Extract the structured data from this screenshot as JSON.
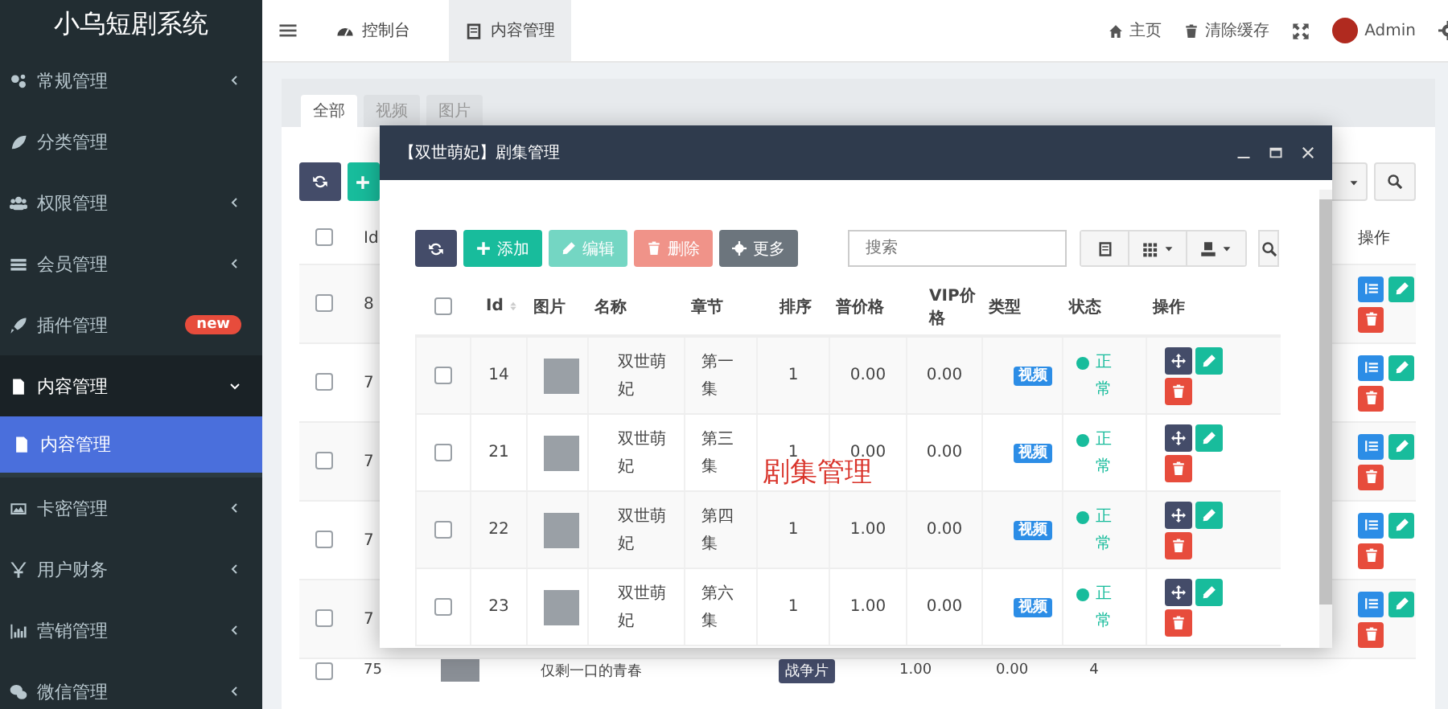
{
  "sidebar": {
    "logo": "小乌短剧系统",
    "items": [
      {
        "label": "常规管理",
        "selected": false,
        "expanded": false
      },
      {
        "label": "分类管理",
        "selected": false
      },
      {
        "label": "权限管理",
        "selected": false,
        "expanded": false
      },
      {
        "label": "会员管理",
        "selected": false,
        "expanded": false
      },
      {
        "label": "插件管理",
        "selected": false,
        "badge": "new"
      },
      {
        "label": "内容管理",
        "selected": false,
        "expanded": true,
        "children": [
          {
            "label": "内容管理",
            "selected": true
          }
        ]
      },
      {
        "label": "卡密管理",
        "selected": false,
        "expanded": false
      },
      {
        "label": "用户财务",
        "selected": false,
        "expanded": false
      },
      {
        "label": "营销管理",
        "selected": false,
        "expanded": false
      },
      {
        "label": "微信管理",
        "selected": false,
        "expanded": false
      }
    ]
  },
  "header": {
    "nav_tabs": [
      {
        "label": "控制台",
        "selected": false
      },
      {
        "label": "内容管理",
        "selected": true
      }
    ],
    "links": [
      "主页",
      "清除缓存"
    ],
    "user": "Admin"
  },
  "panel": {
    "tabs": [
      {
        "label": "全部",
        "selected": true
      },
      {
        "label": "视频",
        "selected": false
      },
      {
        "label": "图片",
        "selected": false
      }
    ],
    "table": {
      "header_checked": false,
      "columns": [
        "Id",
        "操作"
      ],
      "rows": [
        {
          "id": "8",
          "checked": false
        },
        {
          "id": "7",
          "checked": false
        },
        {
          "id": "7",
          "checked": false
        },
        {
          "id": "7",
          "checked": false
        },
        {
          "id": "7",
          "checked": false
        }
      ],
      "last_row": {
        "id": "75",
        "checked": false,
        "name": "仅剩一口的青春",
        "tag": "战争片",
        "price": "1.00",
        "vip_price": "0.00",
        "sort": "4"
      }
    }
  },
  "modal": {
    "title": "【双世萌妃】剧集管理",
    "toolbar": [
      {
        "kind": "add",
        "label": "添加",
        "disabled": false
      },
      {
        "kind": "edit",
        "label": "编辑",
        "disabled": true
      },
      {
        "kind": "delete",
        "label": "删除",
        "disabled": true
      },
      {
        "kind": "more",
        "label": "更多",
        "disabled": false
      }
    ],
    "search": {
      "placeholder": "搜索"
    },
    "header_checked": false,
    "columns": [
      "Id",
      "图片",
      "名称",
      "章节",
      "排序",
      "普价格",
      "VIP价格",
      "类型",
      "状态",
      "操作"
    ],
    "rows": [
      {
        "id": "14",
        "name": "双世萌妃",
        "chapter": "第一集",
        "sort": "1",
        "price": "0.00",
        "vip_price": "0.00",
        "type": "视频",
        "status": "正常",
        "checked": false
      },
      {
        "id": "21",
        "name": "双世萌妃",
        "chapter": "第三集",
        "sort": "1",
        "price": "0.00",
        "vip_price": "0.00",
        "type": "视频",
        "status": "正常",
        "checked": false
      },
      {
        "id": "22",
        "name": "双世萌妃",
        "chapter": "第四集",
        "sort": "1",
        "price": "1.00",
        "vip_price": "0.00",
        "type": "视频",
        "status": "正常",
        "checked": false
      },
      {
        "id": "23",
        "name": "双世萌妃",
        "chapter": "第六集",
        "sort": "1",
        "price": "1.00",
        "vip_price": "0.00",
        "type": "视频",
        "status": "正常",
        "checked": false
      }
    ],
    "annotation": "剧集管理"
  }
}
